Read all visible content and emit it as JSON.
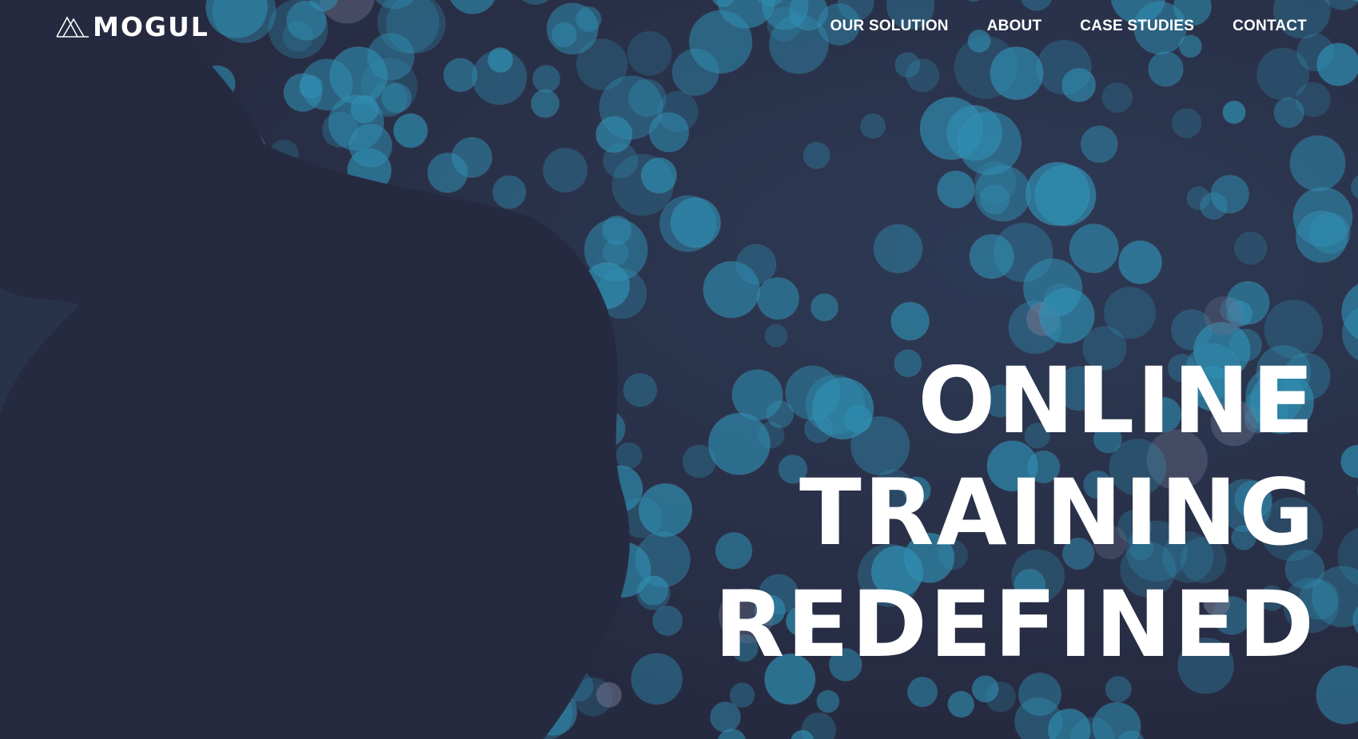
{
  "brand": {
    "name": "MOGUL",
    "logo_icon": "mountain-icon"
  },
  "nav": [
    {
      "label": "OUR SOLUTION"
    },
    {
      "label": "ABOUT"
    },
    {
      "label": "CASE STUDIES"
    },
    {
      "label": "CONTACT"
    }
  ],
  "hero": {
    "headline_lines": [
      "ONLINE",
      "TRAINING",
      "REDEFINED"
    ]
  },
  "colors": {
    "background": "#262a40",
    "bokeh": "#2f8fb3",
    "text": "#ffffff"
  }
}
